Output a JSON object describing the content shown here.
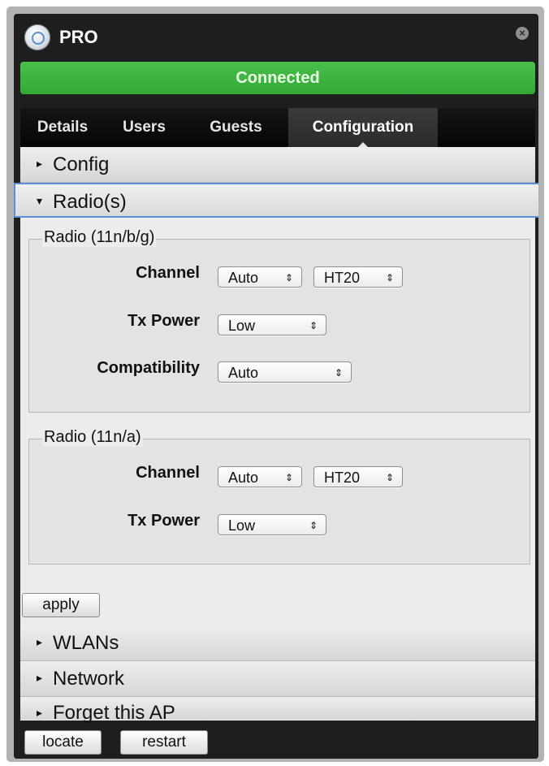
{
  "window": {
    "title": "PRO"
  },
  "status": {
    "text": "Connected",
    "color": "#3db33f"
  },
  "tabs": [
    {
      "label": "Details"
    },
    {
      "label": "Users"
    },
    {
      "label": "Guests"
    },
    {
      "label": "Configuration"
    }
  ],
  "sections": {
    "config": "Config",
    "radios": "Radio(s)",
    "wlans": "WLANs",
    "network": "Network",
    "forget": "Forget this AP"
  },
  "radio_bg": {
    "legend": "Radio (11n/b/g)",
    "channel_label": "Channel",
    "channel_value": "Auto",
    "width_value": "HT20",
    "txpower_label": "Tx Power",
    "txpower_value": "Low",
    "compat_label": "Compatibility",
    "compat_value": "Auto"
  },
  "radio_a": {
    "legend": "Radio (11n/a)",
    "channel_label": "Channel",
    "channel_value": "Auto",
    "width_value": "HT20",
    "txpower_label": "Tx Power",
    "txpower_value": "Low"
  },
  "buttons": {
    "apply": "apply",
    "locate": "locate",
    "restart": "restart"
  },
  "icons": {
    "collapsed": "▸",
    "expanded": "▾",
    "stepper": "⇕",
    "close": "×"
  }
}
